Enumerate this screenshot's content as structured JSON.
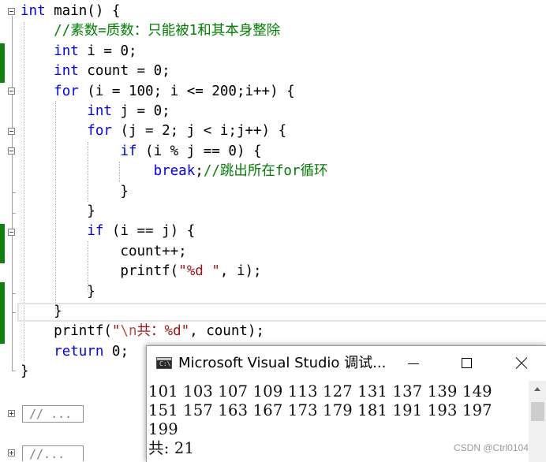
{
  "editor": {
    "code_lines": [
      {
        "parts": [
          {
            "t": "int",
            "c": "kw"
          },
          {
            "t": " main() {",
            "c": ""
          }
        ]
      },
      {
        "parts": [
          {
            "t": "    //素数=质数：只能被1和其本身整除",
            "c": "cm"
          }
        ]
      },
      {
        "parts": [
          {
            "t": "    ",
            "c": ""
          },
          {
            "t": "int",
            "c": "kw"
          },
          {
            "t": " i = 0;",
            "c": ""
          }
        ]
      },
      {
        "parts": [
          {
            "t": "    ",
            "c": ""
          },
          {
            "t": "int",
            "c": "kw"
          },
          {
            "t": " count = 0;",
            "c": ""
          }
        ]
      },
      {
        "parts": [
          {
            "t": "    ",
            "c": ""
          },
          {
            "t": "for",
            "c": "kw"
          },
          {
            "t": " (i = 100; i <= 200;i++) {",
            "c": ""
          }
        ]
      },
      {
        "parts": [
          {
            "t": "        ",
            "c": ""
          },
          {
            "t": "int",
            "c": "kw"
          },
          {
            "t": " j = 0;",
            "c": ""
          }
        ]
      },
      {
        "parts": [
          {
            "t": "        ",
            "c": ""
          },
          {
            "t": "for",
            "c": "kw"
          },
          {
            "t": " (j = 2; j < i;j++) {",
            "c": ""
          }
        ]
      },
      {
        "parts": [
          {
            "t": "            ",
            "c": ""
          },
          {
            "t": "if",
            "c": "kw"
          },
          {
            "t": " (i % j == 0) {",
            "c": ""
          }
        ]
      },
      {
        "parts": [
          {
            "t": "                ",
            "c": ""
          },
          {
            "t": "break",
            "c": "kw"
          },
          {
            "t": ";",
            "c": ""
          },
          {
            "t": "//跳出所在for循环",
            "c": "cm"
          }
        ]
      },
      {
        "parts": [
          {
            "t": "            }",
            "c": ""
          }
        ]
      },
      {
        "parts": [
          {
            "t": "        }",
            "c": ""
          }
        ]
      },
      {
        "parts": [
          {
            "t": "        ",
            "c": ""
          },
          {
            "t": "if",
            "c": "kw"
          },
          {
            "t": " (i == j) {",
            "c": ""
          }
        ]
      },
      {
        "parts": [
          {
            "t": "            count++;",
            "c": ""
          }
        ]
      },
      {
        "parts": [
          {
            "t": "            printf(",
            "c": ""
          },
          {
            "t": "\"%d \"",
            "c": "st"
          },
          {
            "t": ", i);",
            "c": ""
          }
        ]
      },
      {
        "parts": [
          {
            "t": "        }",
            "c": ""
          }
        ]
      },
      {
        "parts": [
          {
            "t": "    }",
            "c": ""
          }
        ]
      },
      {
        "parts": [
          {
            "t": "    printf(",
            "c": ""
          },
          {
            "t": "\"",
            "c": "st"
          },
          {
            "t": "\\n",
            "c": "esc"
          },
          {
            "t": "共：%d\"",
            "c": "st"
          },
          {
            "t": ", count);",
            "c": ""
          }
        ]
      },
      {
        "parts": [
          {
            "t": "    ",
            "c": ""
          },
          {
            "t": "return",
            "c": "kw"
          },
          {
            "t": " 0;",
            "c": ""
          }
        ]
      },
      {
        "parts": [
          {
            "t": "}",
            "c": ""
          }
        ]
      }
    ],
    "collapsed_regions": [
      "// ...",
      "//..."
    ]
  },
  "console": {
    "title": "Microsoft Visual Studio 调试...",
    "output_lines": [
      "101 103 107 109 113 127 131 137 139 149",
      "151 157 163 167 173 179 181 191 193 197",
      "199",
      "共: 21"
    ]
  },
  "watermark": "CSDN @Ctrl0104"
}
